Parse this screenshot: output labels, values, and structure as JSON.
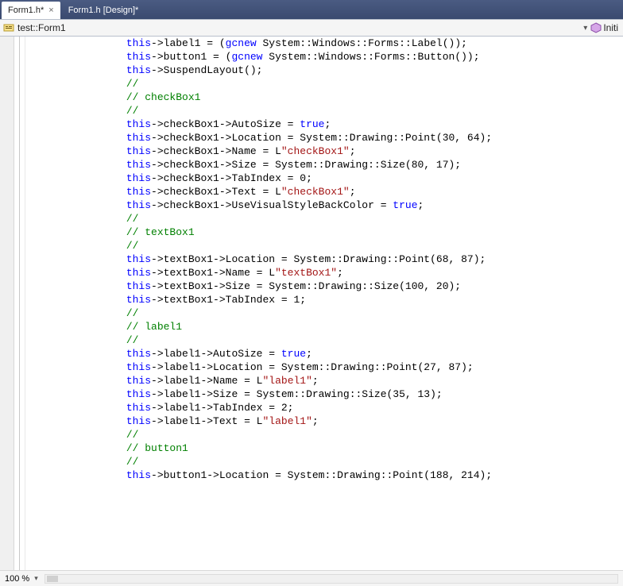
{
  "tabs": {
    "active": {
      "label": "Form1.h*",
      "close": "×"
    },
    "inactive": {
      "label": "Form1.h [Design]*"
    }
  },
  "nav": {
    "scope": "test::Form1",
    "member": "Initi"
  },
  "indent": "                ",
  "code_lines": [
    [
      {
        "c": "kw",
        "t": "this"
      },
      {
        "c": "pln",
        "t": "->label1 = ("
      },
      {
        "c": "kw",
        "t": "gcnew"
      },
      {
        "c": "pln",
        "t": " System::Windows::Forms::Label());"
      }
    ],
    [
      {
        "c": "kw",
        "t": "this"
      },
      {
        "c": "pln",
        "t": "->button1 = ("
      },
      {
        "c": "kw",
        "t": "gcnew"
      },
      {
        "c": "pln",
        "t": " System::Windows::Forms::Button());"
      }
    ],
    [
      {
        "c": "kw",
        "t": "this"
      },
      {
        "c": "pln",
        "t": "->SuspendLayout();"
      }
    ],
    [
      {
        "c": "cmt",
        "t": "// "
      }
    ],
    [
      {
        "c": "cmt",
        "t": "// checkBox1"
      }
    ],
    [
      {
        "c": "cmt",
        "t": "// "
      }
    ],
    [
      {
        "c": "kw",
        "t": "this"
      },
      {
        "c": "pln",
        "t": "->checkBox1->AutoSize = "
      },
      {
        "c": "kw",
        "t": "true"
      },
      {
        "c": "pln",
        "t": ";"
      }
    ],
    [
      {
        "c": "kw",
        "t": "this"
      },
      {
        "c": "pln",
        "t": "->checkBox1->Location = System::Drawing::Point(30, 64);"
      }
    ],
    [
      {
        "c": "kw",
        "t": "this"
      },
      {
        "c": "pln",
        "t": "->checkBox1->Name = L"
      },
      {
        "c": "str",
        "t": "\"checkBox1\""
      },
      {
        "c": "pln",
        "t": ";"
      }
    ],
    [
      {
        "c": "kw",
        "t": "this"
      },
      {
        "c": "pln",
        "t": "->checkBox1->Size = System::Drawing::Size(80, 17);"
      }
    ],
    [
      {
        "c": "kw",
        "t": "this"
      },
      {
        "c": "pln",
        "t": "->checkBox1->TabIndex = 0;"
      }
    ],
    [
      {
        "c": "kw",
        "t": "this"
      },
      {
        "c": "pln",
        "t": "->checkBox1->Text = L"
      },
      {
        "c": "str",
        "t": "\"checkBox1\""
      },
      {
        "c": "pln",
        "t": ";"
      }
    ],
    [
      {
        "c": "kw",
        "t": "this"
      },
      {
        "c": "pln",
        "t": "->checkBox1->UseVisualStyleBackColor = "
      },
      {
        "c": "kw",
        "t": "true"
      },
      {
        "c": "pln",
        "t": ";"
      }
    ],
    [
      {
        "c": "cmt",
        "t": "// "
      }
    ],
    [
      {
        "c": "cmt",
        "t": "// textBox1"
      }
    ],
    [
      {
        "c": "cmt",
        "t": "// "
      }
    ],
    [
      {
        "c": "kw",
        "t": "this"
      },
      {
        "c": "pln",
        "t": "->textBox1->Location = System::Drawing::Point(68, 87);"
      }
    ],
    [
      {
        "c": "kw",
        "t": "this"
      },
      {
        "c": "pln",
        "t": "->textBox1->Name = L"
      },
      {
        "c": "str",
        "t": "\"textBox1\""
      },
      {
        "c": "pln",
        "t": ";"
      }
    ],
    [
      {
        "c": "kw",
        "t": "this"
      },
      {
        "c": "pln",
        "t": "->textBox1->Size = System::Drawing::Size(100, 20);"
      }
    ],
    [
      {
        "c": "kw",
        "t": "this"
      },
      {
        "c": "pln",
        "t": "->textBox1->TabIndex = 1;"
      }
    ],
    [
      {
        "c": "cmt",
        "t": "// "
      }
    ],
    [
      {
        "c": "cmt",
        "t": "// label1"
      }
    ],
    [
      {
        "c": "cmt",
        "t": "// "
      }
    ],
    [
      {
        "c": "kw",
        "t": "this"
      },
      {
        "c": "pln",
        "t": "->label1->AutoSize = "
      },
      {
        "c": "kw",
        "t": "true"
      },
      {
        "c": "pln",
        "t": ";"
      }
    ],
    [
      {
        "c": "kw",
        "t": "this"
      },
      {
        "c": "pln",
        "t": "->label1->Location = System::Drawing::Point(27, 87);"
      }
    ],
    [
      {
        "c": "kw",
        "t": "this"
      },
      {
        "c": "pln",
        "t": "->label1->Name = L"
      },
      {
        "c": "str",
        "t": "\"label1\""
      },
      {
        "c": "pln",
        "t": ";"
      }
    ],
    [
      {
        "c": "kw",
        "t": "this"
      },
      {
        "c": "pln",
        "t": "->label1->Size = System::Drawing::Size(35, 13);"
      }
    ],
    [
      {
        "c": "kw",
        "t": "this"
      },
      {
        "c": "pln",
        "t": "->label1->TabIndex = 2;"
      }
    ],
    [
      {
        "c": "kw",
        "t": "this"
      },
      {
        "c": "pln",
        "t": "->label1->Text = L"
      },
      {
        "c": "str",
        "t": "\"label1\""
      },
      {
        "c": "pln",
        "t": ";"
      }
    ],
    [
      {
        "c": "cmt",
        "t": "// "
      }
    ],
    [
      {
        "c": "cmt",
        "t": "// button1"
      }
    ],
    [
      {
        "c": "cmt",
        "t": "// "
      }
    ],
    [
      {
        "c": "kw",
        "t": "this"
      },
      {
        "c": "pln",
        "t": "->button1->Location = System::Drawing::Point(188, 214);"
      }
    ]
  ],
  "status": {
    "zoom": "100 %"
  }
}
